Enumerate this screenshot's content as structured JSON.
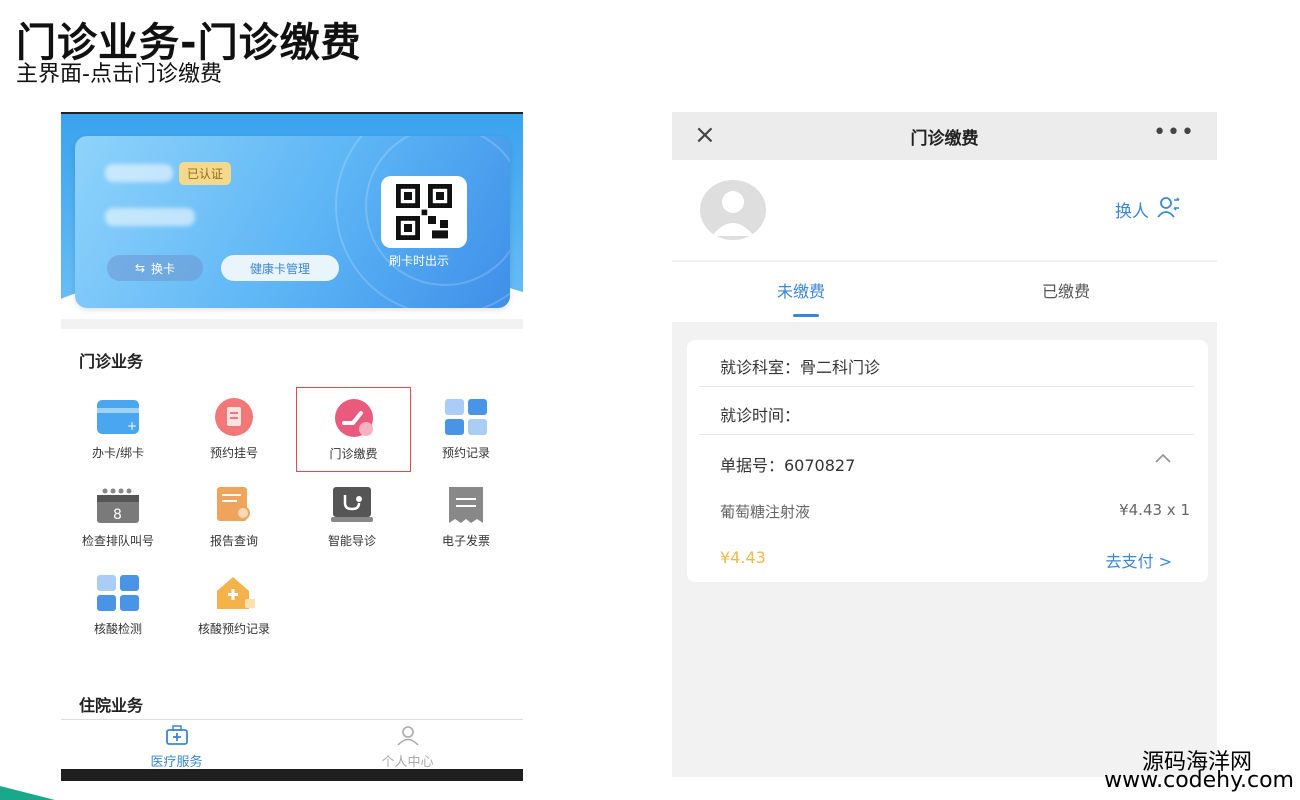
{
  "slide": {
    "title": "门诊业务-门诊缴费",
    "subtitle": "主界面-点击门诊缴费"
  },
  "left_phone": {
    "card": {
      "verified_badge": "已认证",
      "switch_card_button": "换卡",
      "manage_button": "健康卡管理",
      "qr_caption": "刷卡时出示"
    },
    "outpatient_section_title": "门诊业务",
    "services": [
      {
        "label": "办卡/绑卡",
        "icon": "card-icon"
      },
      {
        "label": "预约挂号",
        "icon": "register-icon"
      },
      {
        "label": "门诊缴费",
        "icon": "payment-icon"
      },
      {
        "label": "预约记录",
        "icon": "records-icon"
      },
      {
        "label": "检查排队叫号",
        "icon": "calendar-icon"
      },
      {
        "label": "报告查询",
        "icon": "report-icon"
      },
      {
        "label": "智能导诊",
        "icon": "stethoscope-icon"
      },
      {
        "label": "电子发票",
        "icon": "invoice-icon"
      },
      {
        "label": "核酸检测",
        "icon": "grid-icon"
      },
      {
        "label": "核酸预约记录",
        "icon": "house-medical-icon"
      }
    ],
    "inpatient_section_title": "住院业务",
    "tabbar": {
      "medical_service": "医疗服务",
      "personal_center": "个人中心"
    }
  },
  "right_phone": {
    "nav": {
      "close_icon": "×",
      "title": "门诊缴费",
      "more_icon": "•••"
    },
    "switch_person": "换人",
    "tabs": {
      "unpaid": "未缴费",
      "paid": "已缴费"
    },
    "bill": {
      "department": "就诊科室：骨二科门诊",
      "visit_time_label": "就诊时间：",
      "receipt": "单据号：6070827",
      "item_name": "葡萄糖注射液",
      "item_price": "¥4.43 x 1",
      "total": "¥4.43",
      "pay_link": "去支付 >"
    }
  },
  "watermark": {
    "line1": "源码海洋网",
    "line2": "www.codehy.com"
  },
  "colors": {
    "accent_blue": "#3c86d6",
    "highlight_red": "#e04a4a",
    "price_gold": "#f2b84b"
  }
}
